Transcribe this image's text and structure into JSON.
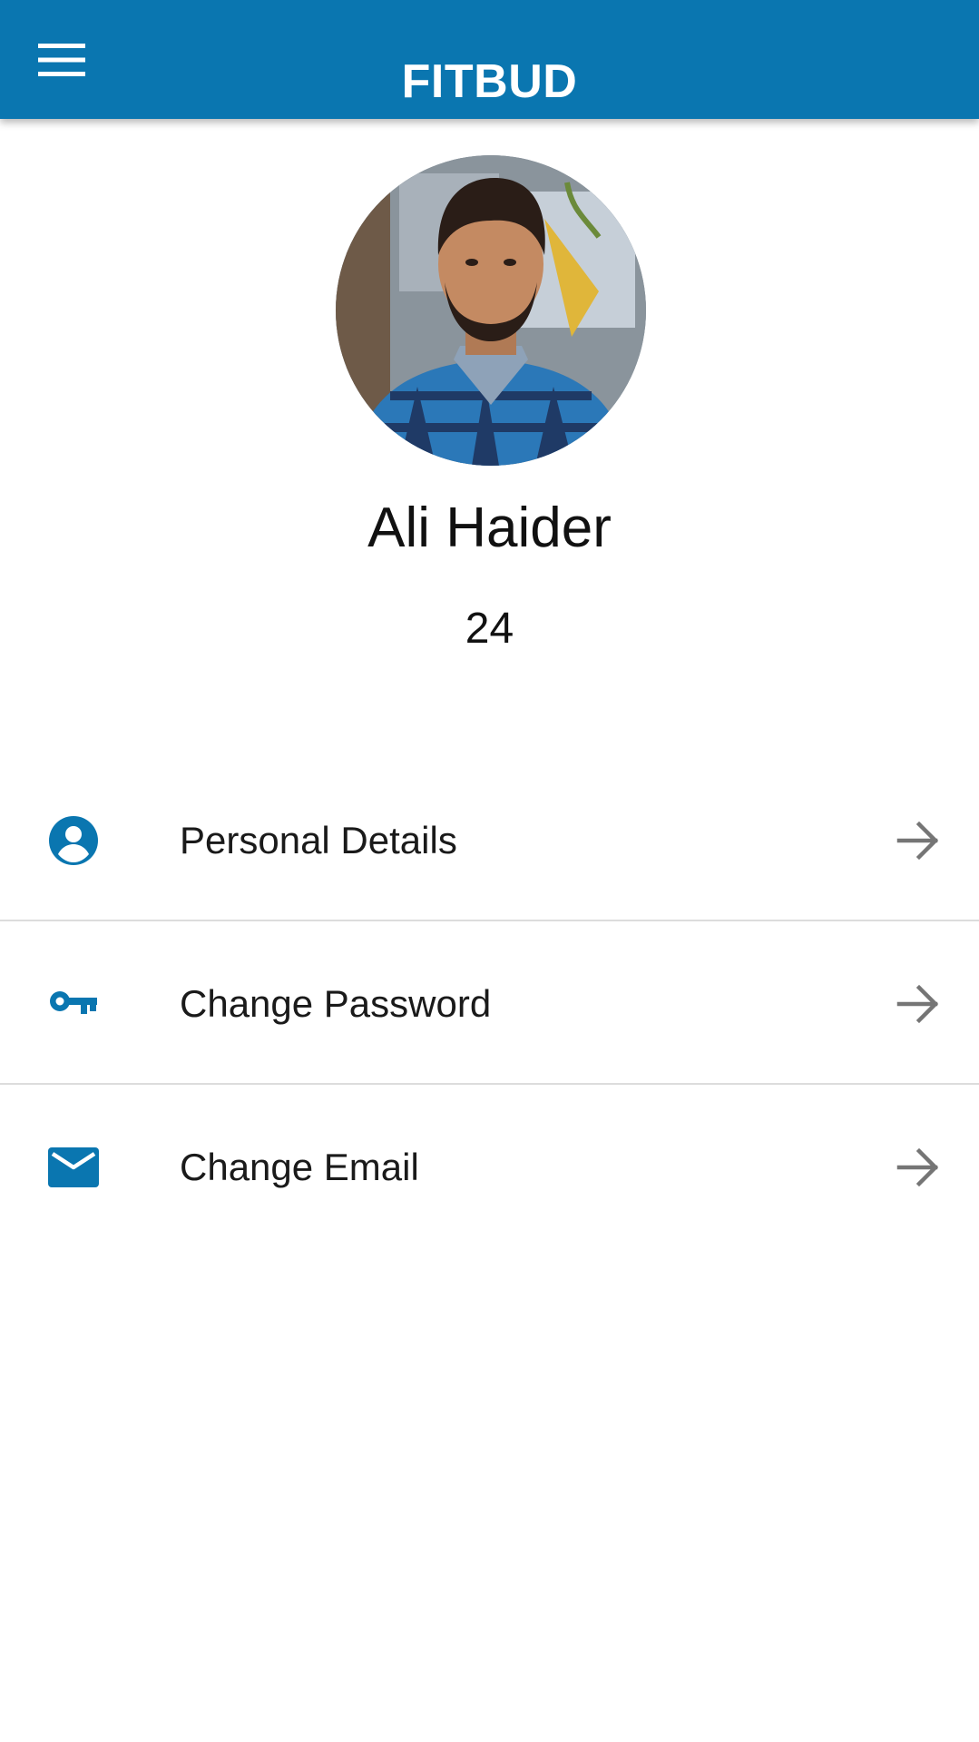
{
  "app": {
    "title": "FITBUD"
  },
  "profile": {
    "name": "Ali Haider",
    "age": "24",
    "avatar_icon": "profile-photo"
  },
  "menu": {
    "items": [
      {
        "label": "Personal Details",
        "icon": "account-circle-icon"
      },
      {
        "label": "Change Password",
        "icon": "key-icon"
      },
      {
        "label": "Change Email",
        "icon": "mail-icon"
      }
    ]
  },
  "colors": {
    "primary": "#0a76b0",
    "accent_icon": "#0a76b0",
    "arrow": "#757575",
    "divider": "#dcdcdc"
  }
}
